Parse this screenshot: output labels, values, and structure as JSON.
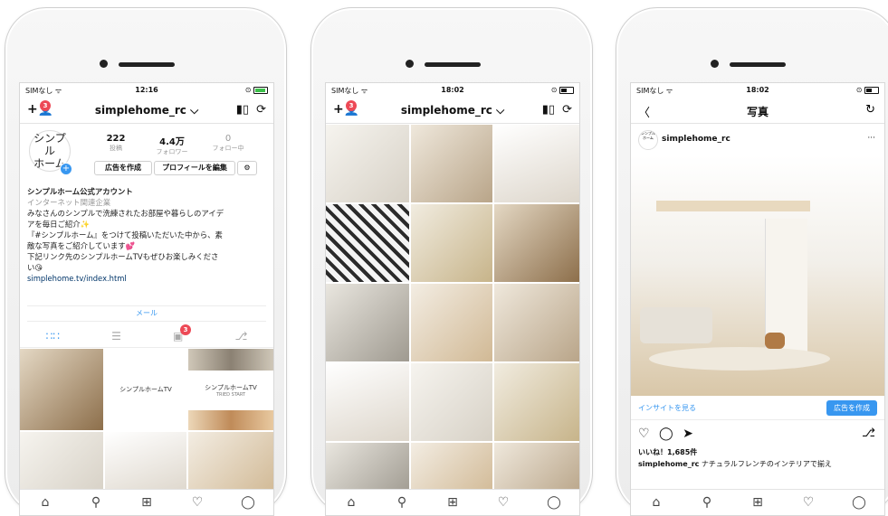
{
  "status": {
    "p1": {
      "carrier": "SIMなし ᯤ",
      "time": "12:16",
      "right": "⊙"
    },
    "p2": {
      "carrier": "SIMなし ᯤ",
      "time": "18:02",
      "right": "⊙"
    },
    "p3": {
      "carrier": "SIMなし ᯤ",
      "time": "18:02",
      "right": "⊙"
    }
  },
  "profile": {
    "username": "simplehome_rc ⌵",
    "follow_requests_badge": "3",
    "inbox_badge": "3",
    "logo_line1": "シンプル",
    "logo_line2": "ホーム",
    "posts_count": "222",
    "posts_label": "投稿",
    "followers_count": "4.4万",
    "followers_label": "フォロワー",
    "following_count": "0",
    "following_label": "フォロー中",
    "promote_button": "広告を作成",
    "edit_profile_button": "プロフィールを編集",
    "name": "シンプルホーム公式アカウント",
    "category": "インターネット関連企業",
    "bio_lines": [
      "みなさんのシンプルで洗練されたお部屋や暮らしのアイデ",
      "アを毎日ご紹介✨",
      "『#シンプルホーム』をつけて投稿いただいた中から、素",
      "敵な写真をご紹介しています💕",
      "下記リンク先のシンプルホームTVもぜひお楽しみくださ",
      "い😘"
    ],
    "link": "simplehome.tv/index.html",
    "email_button": "メール",
    "grid_text_1": "シンプルホームTV",
    "grid_text_2": "シンプルホームTV",
    "grid_text_2_sub": "TRIED START"
  },
  "grid_screen": {
    "username": "simplehome_rc ⌵",
    "follow_requests_badge": "3"
  },
  "post": {
    "back": "〈",
    "title": "写真",
    "refresh": "↻",
    "logo": "シンプル\nホーム",
    "username": "simplehome_rc",
    "more": "···",
    "insights_link": "インサイトを見る",
    "promote_button": "広告を作成",
    "likes": "いいね！1,685件",
    "caption_user": "simplehome_rc",
    "caption_text": "ナチュラルフレンチのインテリアで揃え"
  },
  "tab_icons": [
    "home-icon",
    "search-icon",
    "add-icon",
    "heart-icon",
    "profile-icon"
  ],
  "colors": {
    "badge": "#ed4956",
    "accent": "#3897f0",
    "link": "#003569"
  }
}
